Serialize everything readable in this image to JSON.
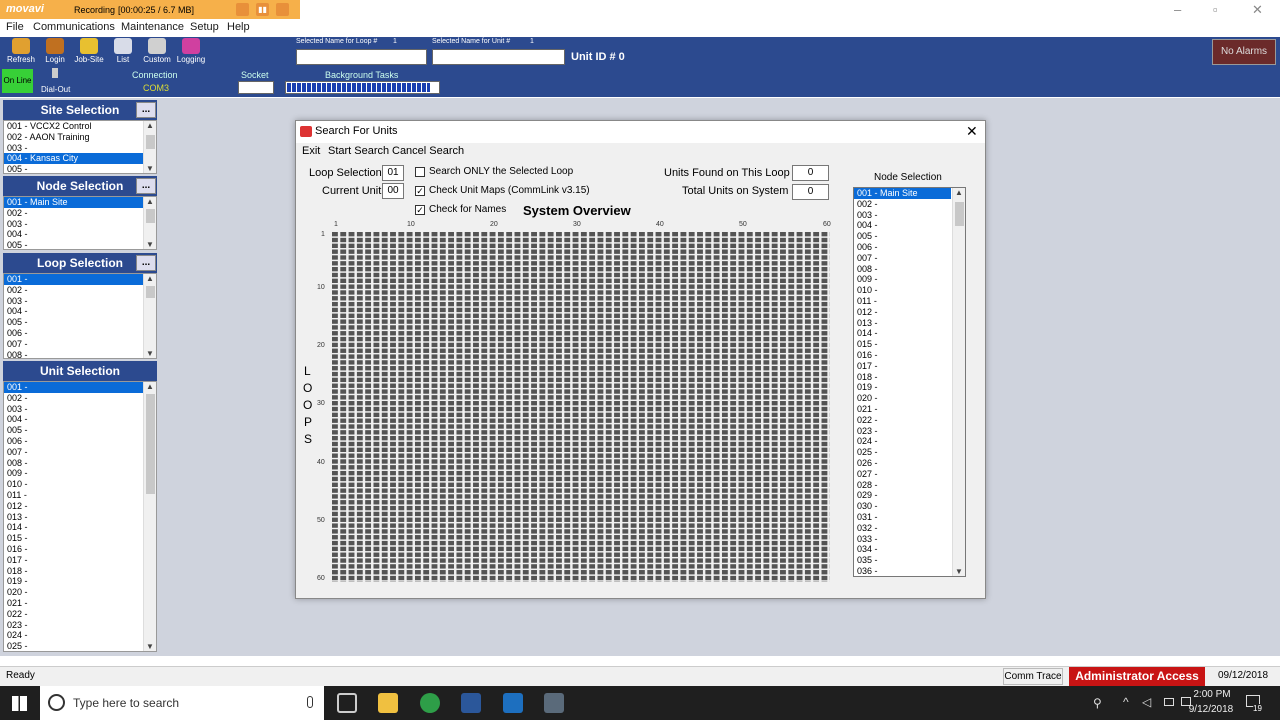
{
  "recorder": {
    "brand": "movavi",
    "status": "Recording",
    "time": "[00:00:25 / 6.7 MB]"
  },
  "menu": [
    "File",
    "Communications",
    "Maintenance",
    "Setup",
    "Help"
  ],
  "toolbar": {
    "buttons": [
      {
        "label": "Refresh",
        "icon": "refresh-icon",
        "color": "#e0a030"
      },
      {
        "label": "Login",
        "icon": "login-icon",
        "color": "#c07020"
      },
      {
        "label": "Job-Site",
        "icon": "job-site-icon",
        "color": "#e8c030"
      },
      {
        "label": "List",
        "icon": "list-icon",
        "color": "#d8dce8"
      },
      {
        "label": "Custom",
        "icon": "custom-icon",
        "color": "#d0d0d0"
      },
      {
        "label": "Logging",
        "icon": "logging-icon",
        "color": "#d040a0"
      }
    ],
    "loop_name_label": "Selected Name for Loop #",
    "loop_name_num": "1",
    "unit_name_label": "Selected Name for Unit #",
    "unit_name_num": "1",
    "unit_id": "Unit ID # 0",
    "alarms": "No Alarms"
  },
  "status_row": {
    "online": "On Line",
    "dialout": "Dial-Out",
    "connection_label": "Connection",
    "connection_value": "COM3",
    "socket_label": "Socket",
    "bg_tasks_label": "Background Tasks"
  },
  "site_selection": {
    "title": "Site Selection",
    "items": [
      "001 - VCCX2 Control",
      "002 - AAON Training",
      "003 -",
      "004 - Kansas City",
      "005 -"
    ],
    "selected_index": 3
  },
  "node_selection_left": {
    "title": "Node Selection",
    "items": [
      "001 - Main Site",
      "002 -",
      "003 -",
      "004 -",
      "005 -"
    ],
    "selected_index": 0
  },
  "loop_selection": {
    "title": "Loop Selection",
    "items": [
      "001 -",
      "002 -",
      "003 -",
      "004 -",
      "005 -",
      "006 -",
      "007 -",
      "008 -"
    ],
    "selected_index": 0
  },
  "unit_selection": {
    "title": "Unit Selection",
    "items": [
      "001 -",
      "002 -",
      "003 -",
      "004 -",
      "005 -",
      "006 -",
      "007 -",
      "008 -",
      "009 -",
      "010 -",
      "011 -",
      "012 -",
      "013 -",
      "014 -",
      "015 -",
      "016 -",
      "017 -",
      "018 -",
      "019 -",
      "020 -",
      "021 -",
      "022 -",
      "023 -",
      "024 -",
      "025 -"
    ],
    "selected_index": 0
  },
  "dialog": {
    "title": "Search For Units",
    "menu": [
      "Exit",
      "Start Search",
      "Cancel Search"
    ],
    "loop_selection_label": "Loop Selection",
    "loop_selection_value": "01",
    "current_unit_label": "Current Unit",
    "current_unit_value": "00",
    "cb_search_only": "Search ONLY the Selected Loop",
    "cb_check_maps": "Check Unit Maps  (CommLink v3.15)",
    "cb_check_names": "Check for Names",
    "units_found_label": "Units Found on This Loop",
    "units_found_value": "0",
    "total_units_label": "Total Units on System",
    "total_units_value": "0",
    "overview_title": "System Overview",
    "loops_letters": [
      "L",
      "O",
      "O",
      "P",
      "S"
    ],
    "x_ticks": [
      "1",
      "10",
      "20",
      "30",
      "40",
      "50",
      "60"
    ],
    "y_ticks": [
      "1",
      "10",
      "20",
      "30",
      "40",
      "50",
      "60"
    ],
    "node_selection_title": "Node Selection",
    "node_items": [
      "001 - Main Site",
      "002 -",
      "003 -",
      "004 -",
      "005 -",
      "006 -",
      "007 -",
      "008 -",
      "009 -",
      "010 -",
      "011 -",
      "012 -",
      "013 -",
      "014 -",
      "015 -",
      "016 -",
      "017 -",
      "018 -",
      "019 -",
      "020 -",
      "021 -",
      "022 -",
      "023 -",
      "024 -",
      "025 -",
      "026 -",
      "027 -",
      "028 -",
      "029 -",
      "030 -",
      "031 -",
      "032 -",
      "033 -",
      "034 -",
      "035 -",
      "036 -"
    ]
  },
  "statusbar": {
    "ready": "Ready",
    "comm_trace": "Comm Trace",
    "admin": "Administrator Access",
    "date": "09/12/2018"
  },
  "taskbar": {
    "search_placeholder": "Type here to search",
    "time": "2:00 PM",
    "date": "9/12/2018",
    "notif": "19"
  }
}
